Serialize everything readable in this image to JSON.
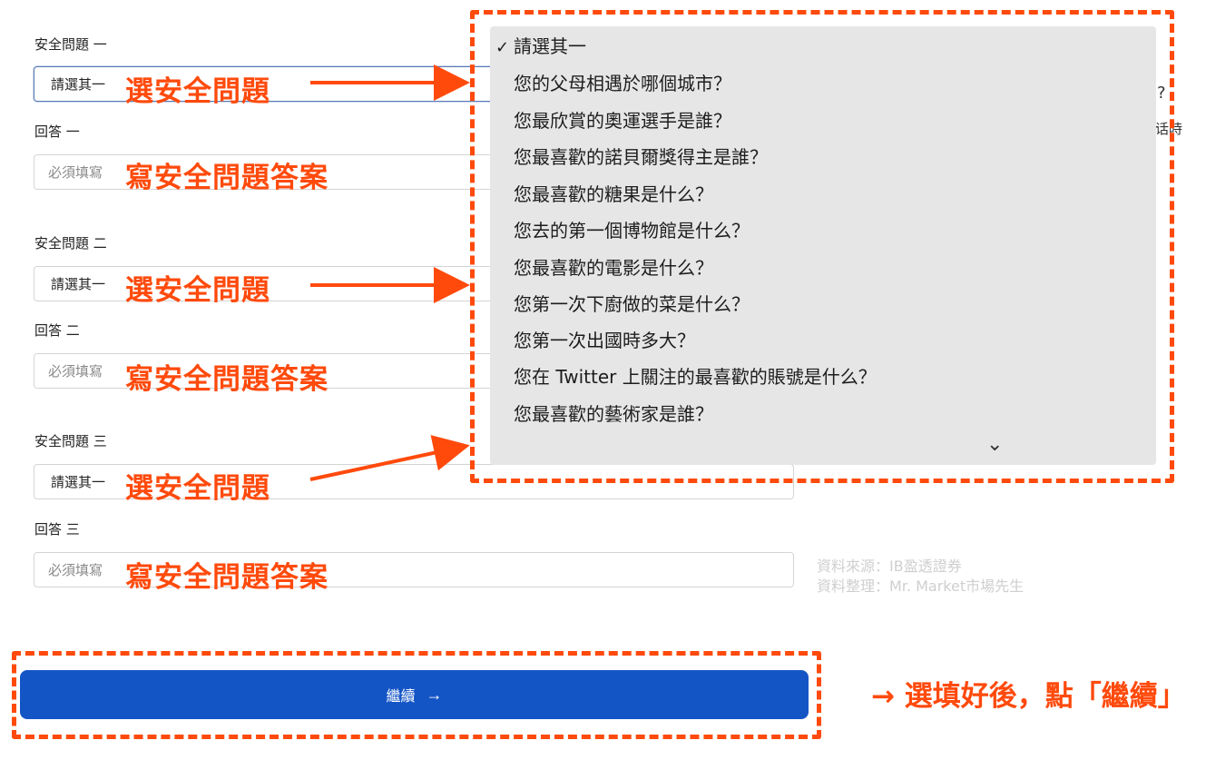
{
  "form": {
    "q1_label": "安全問題 一",
    "q1_value": "請選其一",
    "a1_label": "回答 一",
    "a1_placeholder": "必須填寫",
    "q2_label": "安全問題 二",
    "q2_value": "請選其一",
    "a2_label": "回答 二",
    "a2_placeholder": "必須填寫",
    "q3_label": "安全問題 三",
    "q3_value": "請選其一",
    "a3_label": "回答 三",
    "a3_placeholder": "必須填寫",
    "continue_label": "繼續",
    "continue_arrow": "→"
  },
  "dropdown": {
    "check": "✓",
    "items": [
      "請選其一",
      "您的父母相遇於哪個城市？",
      "您最欣賞的奧運選手是誰？",
      "您最喜歡的諾貝爾獎得主是誰？",
      "您最喜歡的糖果是什么？",
      "您去的第一個博物館是什么？",
      "您最喜歡的電影是什么？",
      "您第一次下廚做的菜是什么？",
      "您第一次出國時多大？",
      "您在 Twitter 上關注的最喜歡的賬號是什么？",
      "您最喜歡的藝術家是誰？"
    ],
    "scroll_indicator": "⌄"
  },
  "peek": {
    "question_mark": "?",
    "partial_text": "话時"
  },
  "annotations": {
    "select_q": "選安全問題",
    "write_a": "寫安全問題答案",
    "bottom": "→ 選填好後，點「繼續」"
  },
  "watermark": {
    "line1": "資料來源：IB盈透證券",
    "line2": "資料整理：Mr. Market市場先生"
  },
  "colors": {
    "annotation": "#ff4a0c",
    "button": "#1455c6",
    "dropdown_bg": "#e6e6e6"
  }
}
